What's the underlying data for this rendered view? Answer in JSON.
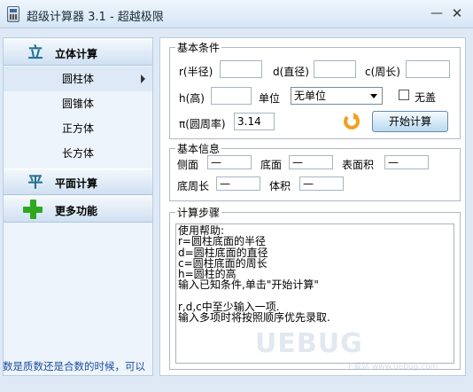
{
  "window": {
    "title": "超级计算器 3.1 - 超越极限",
    "minimize_symbol": "—",
    "close_symbol": "✕"
  },
  "sidebar": {
    "categories": [
      {
        "label": "立体计算",
        "icon_glyph": "立"
      },
      {
        "label": "平面计算",
        "icon_glyph": "平"
      },
      {
        "label": "更多功能"
      }
    ],
    "solid_items": [
      {
        "label": "圆柱体"
      },
      {
        "label": "圆锥体"
      },
      {
        "label": "正方体"
      },
      {
        "label": "长方体"
      }
    ],
    "status_text": "数是质数还是合数的时候，可以"
  },
  "basic_conditions": {
    "legend": "基本条件",
    "radius_label": "r(半径)",
    "diameter_label": "d(直径)",
    "circumference_label": "c(周长)",
    "height_label": "h(高)",
    "unit_label": "单位",
    "unit_value": "无单位",
    "no_cover_label": "无盖",
    "pi_label": "π(圆周率)",
    "pi_value": "3.14",
    "calc_button": "开始计算"
  },
  "basic_info": {
    "legend": "基本信息",
    "side_label": "侧面",
    "side_value": "—",
    "base_label": "底面",
    "base_value": "—",
    "surface_label": "表面积",
    "surface_value": "—",
    "base_perimeter_label": "底周长",
    "base_perimeter_value": "—",
    "volume_label": "体积",
    "volume_value": "—"
  },
  "steps": {
    "legend": "计算步骤",
    "text": "使用帮助:\nr=圆柱底面的半径\nd=圆柱底面的直径\nc=圆柱底面的周长\nh=圆柱的高\n输入已知条件,单击\"开始计算\"\n\nr,d,c中至少输入一项.\n输入多项时将按照顺序优先录取."
  },
  "watermark": {
    "main": "UEBUG",
    "sub": "下载站 www.uebug.com"
  },
  "icons": {
    "app": "calculator-icon",
    "solid": "solid-category-icon",
    "plane": "plane-category-icon",
    "more": "plus-icon",
    "refresh": "refresh-icon"
  },
  "colors": {
    "accent": "#2ea81e",
    "refresh": "#f0a020",
    "status_text": "#1a4ea0"
  }
}
